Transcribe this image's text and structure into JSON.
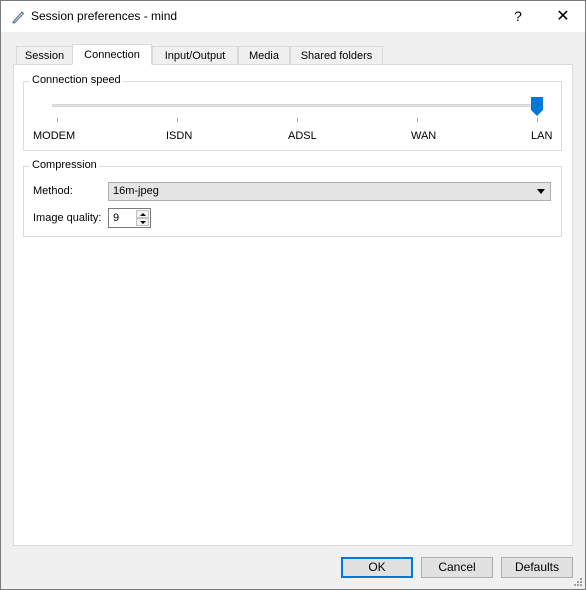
{
  "window": {
    "title": "Session preferences - mind",
    "help_label": "?",
    "close_label": "✕"
  },
  "tabs": [
    {
      "label": "Session",
      "active": false
    },
    {
      "label": "Connection",
      "active": true
    },
    {
      "label": "Input/Output",
      "active": false
    },
    {
      "label": "Media",
      "active": false
    },
    {
      "label": "Shared folders",
      "active": false
    }
  ],
  "connection_speed": {
    "title": "Connection speed",
    "ticks": [
      "MODEM",
      "ISDN",
      "ADSL",
      "WAN",
      "LAN"
    ],
    "selected": "LAN"
  },
  "compression": {
    "title": "Compression",
    "method_label": "Method:",
    "method_value": "16m-jpeg",
    "quality_label": "Image quality:",
    "quality_value": "9"
  },
  "buttons": {
    "ok": "OK",
    "cancel": "Cancel",
    "defaults": "Defaults"
  },
  "colors": {
    "accent": "#0078d7",
    "titlebar": "#ffffff",
    "dialog_bg": "#f0f0f0"
  },
  "icons": {
    "app": "pencil-icon",
    "help": "question-mark",
    "close": "x-mark",
    "grip": "resize-grip"
  }
}
